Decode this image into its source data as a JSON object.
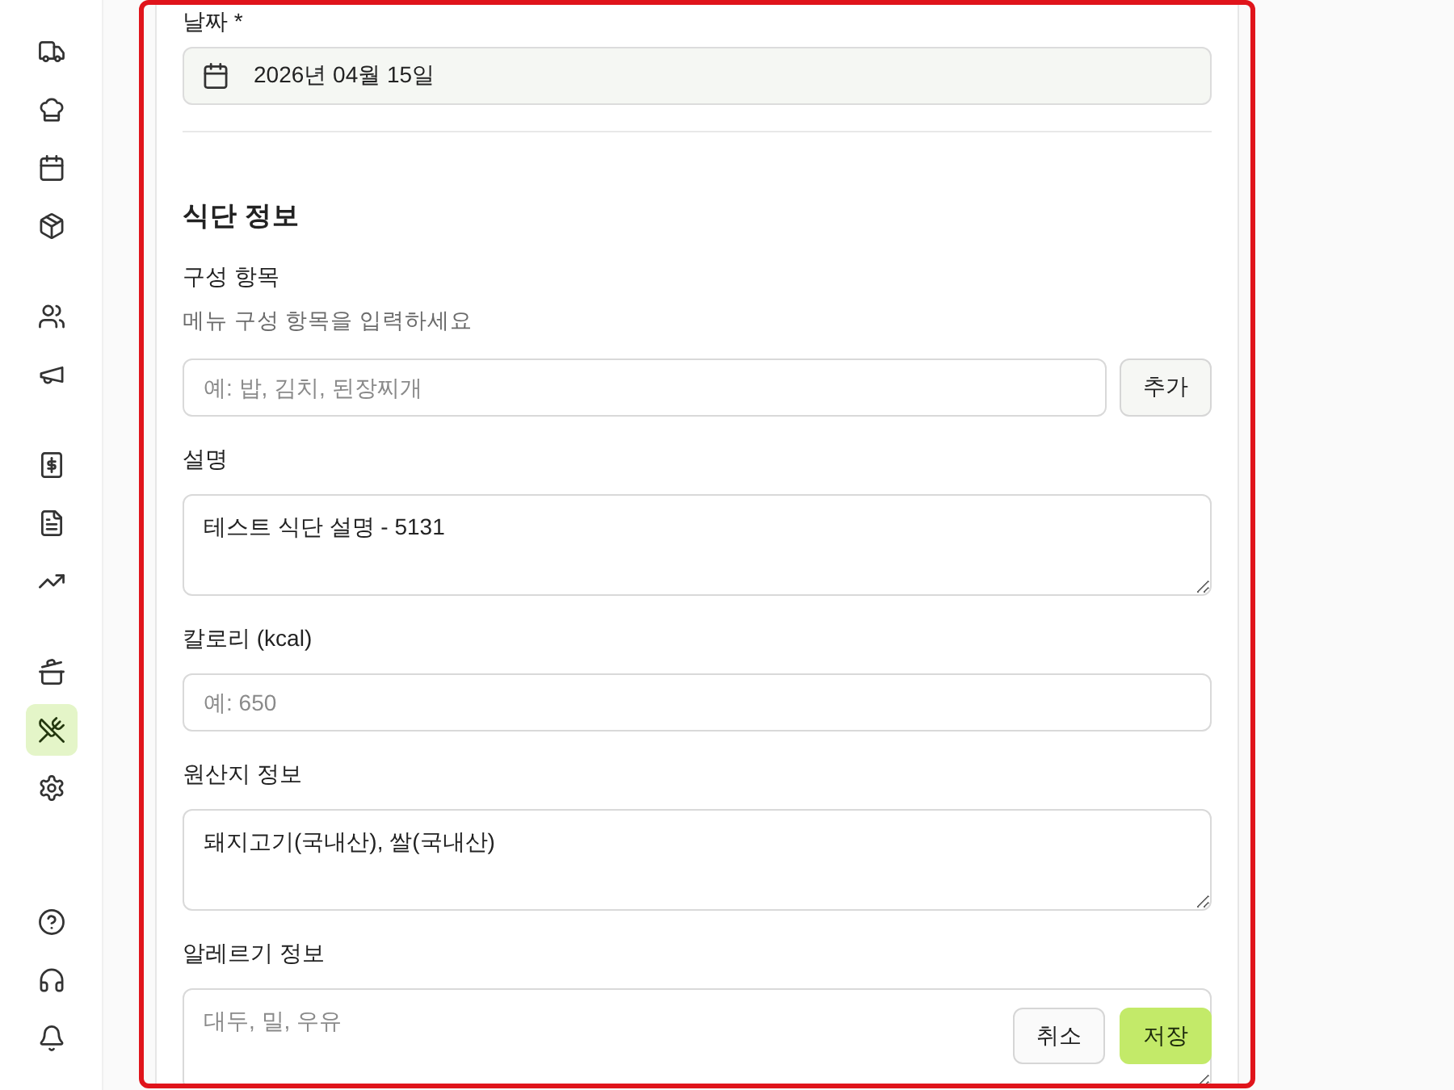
{
  "sidebar": {
    "top_groups": [
      [
        {
          "selected": false
        },
        {
          "selected": false
        },
        {
          "selected": false
        },
        {
          "selected": false
        }
      ],
      [
        {
          "selected": false
        },
        {
          "selected": false
        }
      ],
      [
        {
          "selected": false
        },
        {
          "selected": false
        },
        {
          "selected": false
        }
      ],
      [
        {
          "selected": false
        },
        {
          "selected": true
        },
        {
          "selected": false
        }
      ]
    ],
    "bottom_items": [
      {
        "selected": false
      },
      {
        "selected": false
      },
      {
        "selected": false
      }
    ]
  },
  "form": {
    "date": {
      "label": "날짜 *",
      "value": "2026년 04월 15일"
    },
    "section_title": "식단 정보",
    "fields": [
      {
        "kind": "tags-input",
        "label": "구성 항목",
        "help": "메뉴 구성 항목을 입력하세요",
        "placeholder": "예: 밥, 김치, 된장찌개",
        "button": "추가"
      },
      {
        "kind": "textarea",
        "label": "설명",
        "value": "테스트 식단 설명 - 5131"
      },
      {
        "kind": "input",
        "label": "칼로리 (kcal)",
        "placeholder": "예: 650"
      },
      {
        "kind": "textarea",
        "label": "원산지 정보",
        "value": "돼지고기(국내산), 쌀(국내산)"
      },
      {
        "kind": "textarea",
        "label": "알레르기 정보",
        "placeholder": "대두, 밀, 우유"
      }
    ],
    "actions": [
      {
        "kind": "secondary",
        "label": "취소"
      },
      {
        "kind": "primary",
        "label": "저장"
      }
    ]
  }
}
